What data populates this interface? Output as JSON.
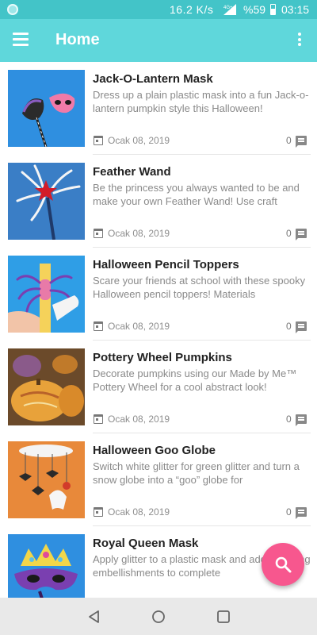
{
  "status_bar": {
    "network_speed": "16.2 K/s",
    "signal_label": "4G+",
    "battery": "%59",
    "time": "03:15"
  },
  "app_bar": {
    "title": "Home",
    "menu_icon": "hamburger-menu-icon",
    "overflow_icon": "more-vert-icon"
  },
  "items": [
    {
      "title": "Jack-O-Lantern Mask",
      "description": "Dress up a plain plastic mask into a fun Jack-o-lantern pumpkin style this Halloween!",
      "date": "Ocak 08, 2019",
      "comments": "0"
    },
    {
      "title": "Feather Wand",
      "description": "Be the princess you always wanted to be and make your own Feather Wand! Use craft",
      "date": "Ocak 08, 2019",
      "comments": "0"
    },
    {
      "title": "Halloween Pencil Toppers",
      "description": "Scare your friends at school with these spooky Halloween pencil toppers! Materials",
      "date": "Ocak 08, 2019",
      "comments": "0"
    },
    {
      "title": "Pottery Wheel Pumpkins",
      "description": "Decorate pumpkins using our Made by Me™ Pottery Wheel for a cool abstract look!",
      "date": "Ocak 08, 2019",
      "comments": "0"
    },
    {
      "title": "Halloween Goo Globe",
      "description": "Switch white glitter for green glitter and turn a snow globe into a “goo” globe for",
      "date": "Ocak 08, 2019",
      "comments": "0"
    },
    {
      "title": "Royal Queen Mask",
      "description": "Apply glitter to a plastic mask and add sparkling embellishments to complete",
      "date": "",
      "comments": ""
    }
  ],
  "fab": {
    "icon": "search-icon"
  },
  "nav_bar": {
    "back_icon": "back-triangle-icon",
    "home_icon": "home-circle-icon",
    "recents_icon": "recents-square-icon"
  },
  "colors": {
    "status_bar": "#43c4c8",
    "app_bar": "#5fd7db",
    "fab": "#f7578e",
    "title_text": "#222222",
    "description_text": "#8a8a8a"
  }
}
